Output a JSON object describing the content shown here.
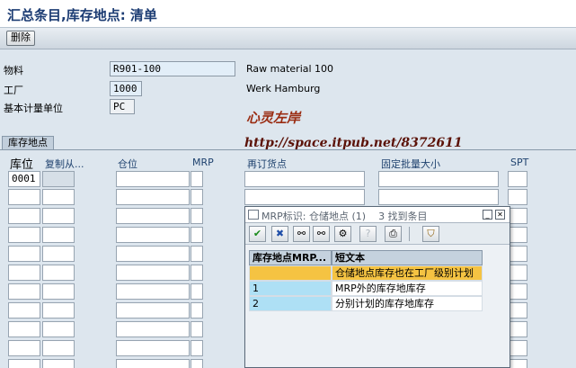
{
  "title": "汇总条目,库存地点: 清单",
  "toolbar": {
    "delete_label": "删除"
  },
  "header": {
    "material_label": "物料",
    "material_value": "R901-100",
    "material_desc": "Raw material 100",
    "plant_label": "工厂",
    "plant_value": "1000",
    "plant_desc": "Werk Hamburg",
    "uom_label": "基本计量单位",
    "uom_value": "PC"
  },
  "watermark": {
    "signature": "心灵左岸",
    "url": "http://space.itpub.net/8372611"
  },
  "tab": {
    "label": "库存地点"
  },
  "columns": {
    "sloc": "库位",
    "copy_from": "复制从...",
    "warehouse": "仓位",
    "mrp": "MRP",
    "reorder_point": "再订货点",
    "fixed_lot": "固定批量大小",
    "spt": "SPT"
  },
  "rows": [
    {
      "sloc": "0001"
    }
  ],
  "popup": {
    "title": "MRP标识: 仓储地点 (1)",
    "count_text": "3 找到条目",
    "col1": "库存地点MRP...",
    "col2": "短文本",
    "entries": [
      {
        "key": "",
        "text": "仓储地点库存也在工厂级别计划",
        "highlight": "#f5c342"
      },
      {
        "key": "1",
        "text": "MRP外的库存地库存",
        "highlight": "#aee0f5"
      },
      {
        "key": "2",
        "text": "分别计划的库存地库存",
        "highlight": "#aee0f5"
      }
    ]
  }
}
